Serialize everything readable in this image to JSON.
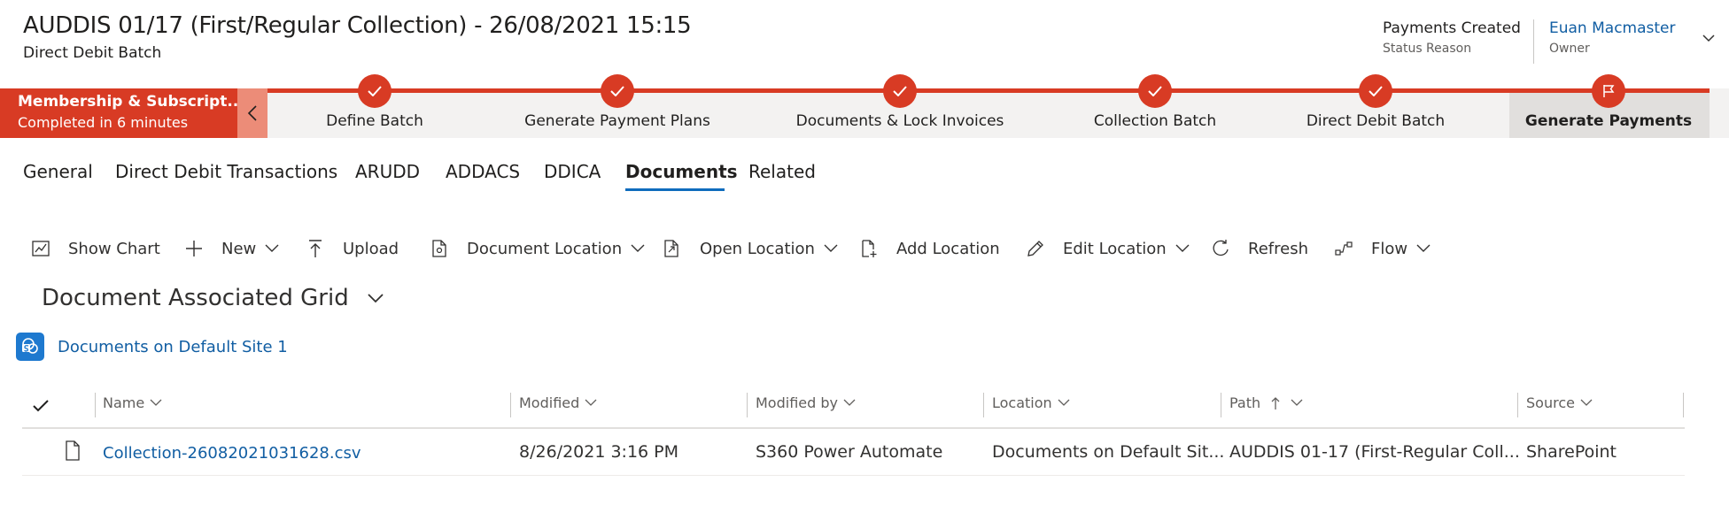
{
  "header": {
    "title": "AUDDIS 01/17 (First/Regular Collection)  - 26/08/2021 15:15",
    "entity": "Direct Debit Batch",
    "status_value": "Payments Created",
    "status_label": "Status Reason",
    "owner_value": "Euan Macmaster",
    "owner_label": "Owner"
  },
  "bpf": {
    "process_name": "Membership & Subscript...",
    "process_status": "Completed in 6 minutes",
    "stages": [
      {
        "label": "Define Batch",
        "state": "completed",
        "icon": "check-icon"
      },
      {
        "label": "Generate Payment Plans",
        "state": "completed",
        "icon": "check-icon"
      },
      {
        "label": "Documents & Lock Invoices",
        "state": "completed",
        "icon": "check-icon"
      },
      {
        "label": "Collection Batch",
        "state": "completed",
        "icon": "check-icon"
      },
      {
        "label": "Direct Debit Batch",
        "state": "completed",
        "icon": "check-icon"
      },
      {
        "label": "Generate Payments",
        "state": "selected",
        "icon": "flag-icon"
      }
    ],
    "accent_color": "#d83b24"
  },
  "tabs": [
    {
      "label": "General"
    },
    {
      "label": "Direct Debit Transactions"
    },
    {
      "label": "ARUDD"
    },
    {
      "label": "ADDACS"
    },
    {
      "label": "DDICA"
    },
    {
      "label": "Documents",
      "active": true
    },
    {
      "label": "Related"
    }
  ],
  "commands": [
    {
      "label": "Show Chart",
      "icon": "chart-icon"
    },
    {
      "label": "New",
      "icon": "plus-icon",
      "dropdown": true
    },
    {
      "label": "Upload",
      "icon": "upload-icon"
    },
    {
      "label": "Document Location",
      "icon": "document-location-icon",
      "dropdown": true
    },
    {
      "label": "Open Location",
      "icon": "open-location-icon",
      "dropdown": true
    },
    {
      "label": "Add Location",
      "icon": "add-location-icon"
    },
    {
      "label": "Edit Location",
      "icon": "pencil-icon",
      "dropdown": true
    },
    {
      "label": "Refresh",
      "icon": "refresh-icon"
    },
    {
      "label": "Flow",
      "icon": "flow-icon",
      "dropdown": true
    }
  ],
  "grid": {
    "title": "Document Associated Grid",
    "site_link": "Documents on Default Site 1",
    "site_icon": "sharepoint-icon",
    "columns": [
      {
        "label": "Name",
        "sort": "none"
      },
      {
        "label": "Modified",
        "sort": "none"
      },
      {
        "label": "Modified by",
        "sort": "none"
      },
      {
        "label": "Location",
        "sort": "none"
      },
      {
        "label": "Path",
        "sort": "ascending"
      },
      {
        "label": "Source",
        "sort": "none"
      }
    ],
    "rows": [
      {
        "icon": "file-icon",
        "name": "Collection-26082021031628.csv",
        "modified": "8/26/2021 3:16 PM",
        "modified_by": "S360 Power Automate",
        "location": "Documents on Default Sit...",
        "path": "AUDDIS 01-17 (First-Regular Coll...",
        "source": "SharePoint"
      }
    ]
  }
}
